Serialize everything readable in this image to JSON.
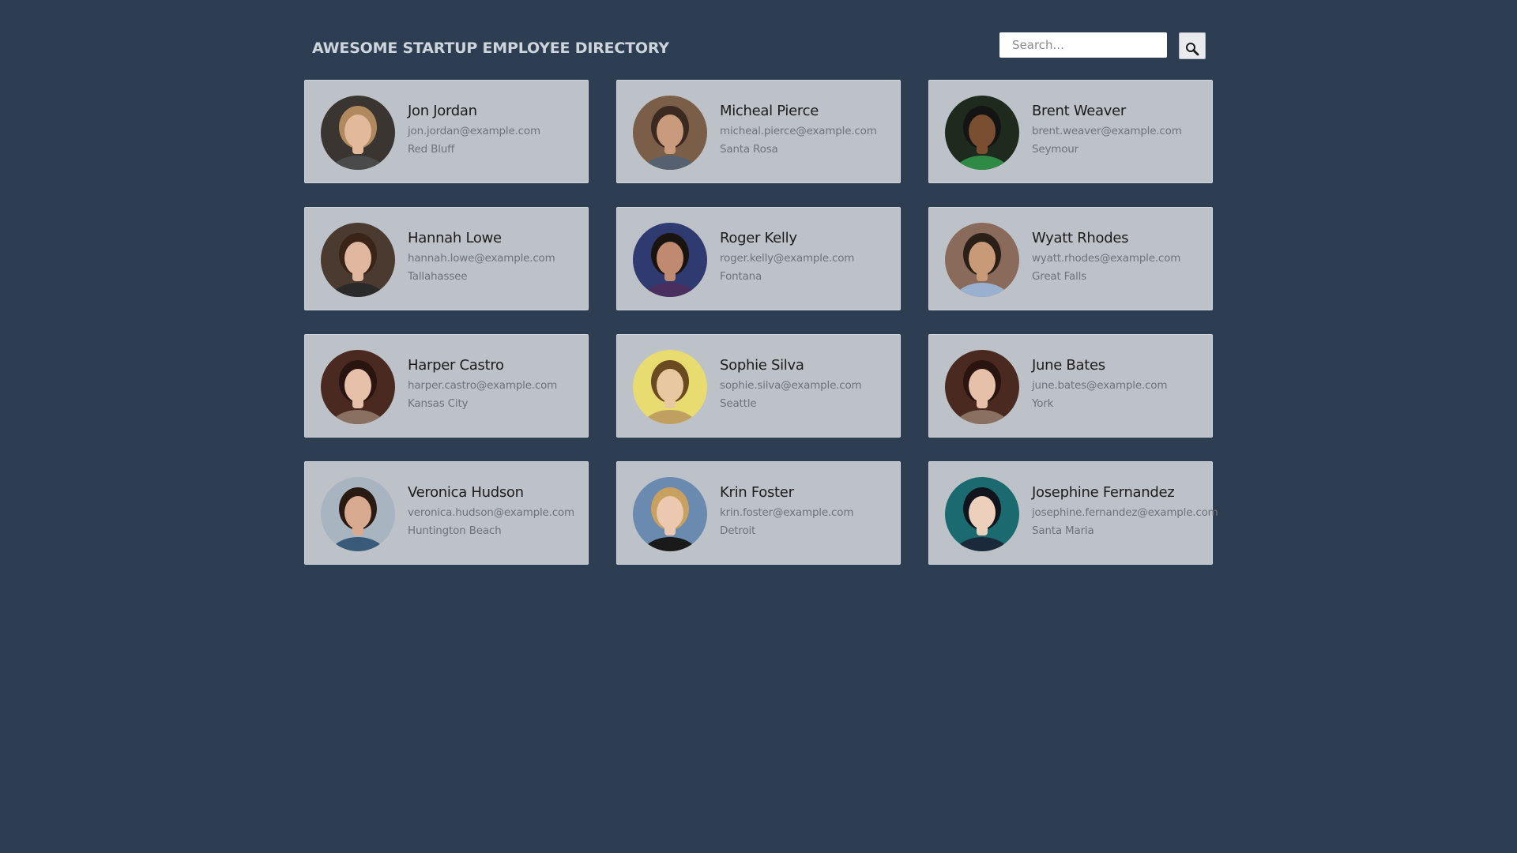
{
  "header": {
    "title": "AWESOME STARTUP EMPLOYEE DIRECTORY",
    "search_placeholder": "Search...",
    "search_value": "",
    "search_icon": "magnifier-icon"
  },
  "colors": {
    "background": "#2e3e52",
    "card": "#bcc2c8",
    "title": "#cdd4dc"
  },
  "employees": [
    {
      "name": "Jon Jordan",
      "email": "jon.jordan@example.com",
      "city": "Red Bluff",
      "avatar": {
        "bg": "#3a3530",
        "skin": "#e2b99a",
        "hair": "#b08a5e",
        "shirt": "#4a4a4a"
      }
    },
    {
      "name": "Micheal Pierce",
      "email": "micheal.pierce@example.com",
      "city": "Santa Rosa",
      "avatar": {
        "bg": "#7a5e48",
        "skin": "#c99a7c",
        "hair": "#3a2a20",
        "shirt": "#556070"
      }
    },
    {
      "name": "Brent Weaver",
      "email": "brent.weaver@example.com",
      "city": "Seymour",
      "avatar": {
        "bg": "#1f2a1e",
        "skin": "#7a4e30",
        "hair": "#141414",
        "shirt": "#2f8a45"
      }
    },
    {
      "name": "Hannah Lowe",
      "email": "hannah.lowe@example.com",
      "city": "Tallahassee",
      "avatar": {
        "bg": "#4a3a30",
        "skin": "#e0b8a0",
        "hair": "#3a2418",
        "shirt": "#2a2a2a"
      }
    },
    {
      "name": "Roger Kelly",
      "email": "roger.kelly@example.com",
      "city": "Fontana",
      "avatar": {
        "bg": "#2e3a70",
        "skin": "#c08a70",
        "hair": "#1a1410",
        "shirt": "#4a2e60"
      }
    },
    {
      "name": "Wyatt Rhodes",
      "email": "wyatt.rhodes@example.com",
      "city": "Great Falls",
      "avatar": {
        "bg": "#8a6a5a",
        "skin": "#c89a78",
        "hair": "#2a2018",
        "shirt": "#9ab0d0"
      }
    },
    {
      "name": "Harper Castro",
      "email": "harper.castro@example.com",
      "city": "Kansas City",
      "avatar": {
        "bg": "#4a2a20",
        "skin": "#e6c0a8",
        "hair": "#2a1410",
        "shirt": "#8a7060"
      }
    },
    {
      "name": "Sophie Silva",
      "email": "sophie.silva@example.com",
      "city": "Seattle",
      "avatar": {
        "bg": "#e8dc70",
        "skin": "#e8c8a0",
        "hair": "#6a4a20",
        "shirt": "#c0a060"
      }
    },
    {
      "name": "June Bates",
      "email": "june.bates@example.com",
      "city": "York",
      "avatar": {
        "bg": "#4a2a20",
        "skin": "#e6c0a8",
        "hair": "#2a1410",
        "shirt": "#8a7060"
      }
    },
    {
      "name": "Veronica Hudson",
      "email": "veronica.hudson@example.com",
      "city": "Huntington Beach",
      "avatar": {
        "bg": "#a8b4c0",
        "skin": "#d8aa90",
        "hair": "#2a1a14",
        "shirt": "#3a5a7a"
      }
    },
    {
      "name": "Krin Foster",
      "email": "krin.foster@example.com",
      "city": "Detroit",
      "avatar": {
        "bg": "#6a8ab0",
        "skin": "#ecc8b0",
        "hair": "#c8a060",
        "shirt": "#1a1a1a"
      }
    },
    {
      "name": "Josephine Fernandez",
      "email": "josephine.fernandez@example.com",
      "city": "Santa Maria",
      "avatar": {
        "bg": "#1a6a70",
        "skin": "#ecd0bc",
        "hair": "#10141c",
        "shirt": "#1a2a3a"
      }
    }
  ]
}
